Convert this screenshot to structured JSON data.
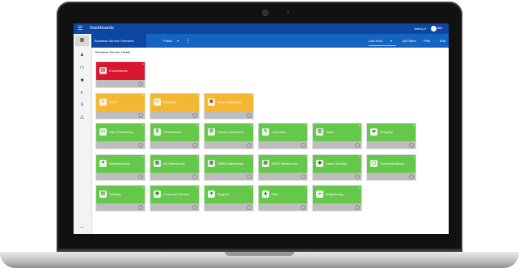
{
  "topbar": {
    "menu_icon": "hamburger-icon",
    "title": "Dashboards",
    "user": "Jeffrey ▾",
    "logo_text": "IBM"
  },
  "sidebar": {
    "icons": [
      "grid-icon",
      "warning-icon",
      "monitor-icon",
      "briefcase-icon",
      "phone-icon",
      "list-icon",
      "alert-icon",
      "minus-icon"
    ]
  },
  "subbar": {
    "active_tab": "Business Service Overview",
    "visibility": "Public",
    "time_range": "Last Hour",
    "filters": "All Filters",
    "print": "Print",
    "edit": "Edit"
  },
  "section": {
    "heading": "Business Service Health"
  },
  "colors": {
    "topbar": "#0d47a1",
    "subbar": "#1565c0",
    "critical": "#d91630",
    "warning": "#f4b731",
    "normal": "#66c84a"
  },
  "tiles": [
    {
      "label": "E-commerce",
      "status": "critical",
      "icon": "store-icon"
    },
    {
      "label": "CRM",
      "status": "warning",
      "icon": "people-icon"
    },
    {
      "label": "Payables",
      "status": "warning",
      "icon": "card-icon"
    },
    {
      "label": "Order Fulfillment",
      "status": "warning",
      "icon": "box-icon"
    },
    {
      "label": "Card Processing",
      "status": "normal",
      "icon": "card-icon"
    },
    {
      "label": "Receivables",
      "status": "normal",
      "icon": "money-icon"
    },
    {
      "label": "Human Resources",
      "status": "normal",
      "icon": "gear-icon"
    },
    {
      "label": "Contracts",
      "status": "normal",
      "icon": "pen-icon"
    },
    {
      "label": "Sales",
      "status": "normal",
      "icon": "chart-icon"
    },
    {
      "label": "Shipping",
      "status": "normal",
      "icon": "truck-icon"
    },
    {
      "label": "Manufacturing",
      "status": "normal",
      "icon": "wrench-icon"
    },
    {
      "label": "NA Warehouse",
      "status": "normal",
      "icon": "building-icon"
    },
    {
      "label": "EMEA Warehouse",
      "status": "normal",
      "icon": "building-icon"
    },
    {
      "label": "APAC Warehouse",
      "status": "normal",
      "icon": "building-icon"
    },
    {
      "label": "Cyber Security",
      "status": "normal",
      "icon": "shield-icon"
    },
    {
      "label": "Communications",
      "status": "normal",
      "icon": "chat-icon"
    },
    {
      "label": "Training",
      "status": "normal",
      "icon": "board-icon"
    },
    {
      "label": "Customer Service",
      "status": "normal",
      "icon": "headset-icon"
    },
    {
      "label": "Support",
      "status": "normal",
      "icon": "bulb-icon"
    },
    {
      "label": "R&D",
      "status": "normal",
      "icon": "flask-icon"
    },
    {
      "label": "Engineering",
      "status": "normal",
      "icon": "helmet-icon"
    }
  ]
}
